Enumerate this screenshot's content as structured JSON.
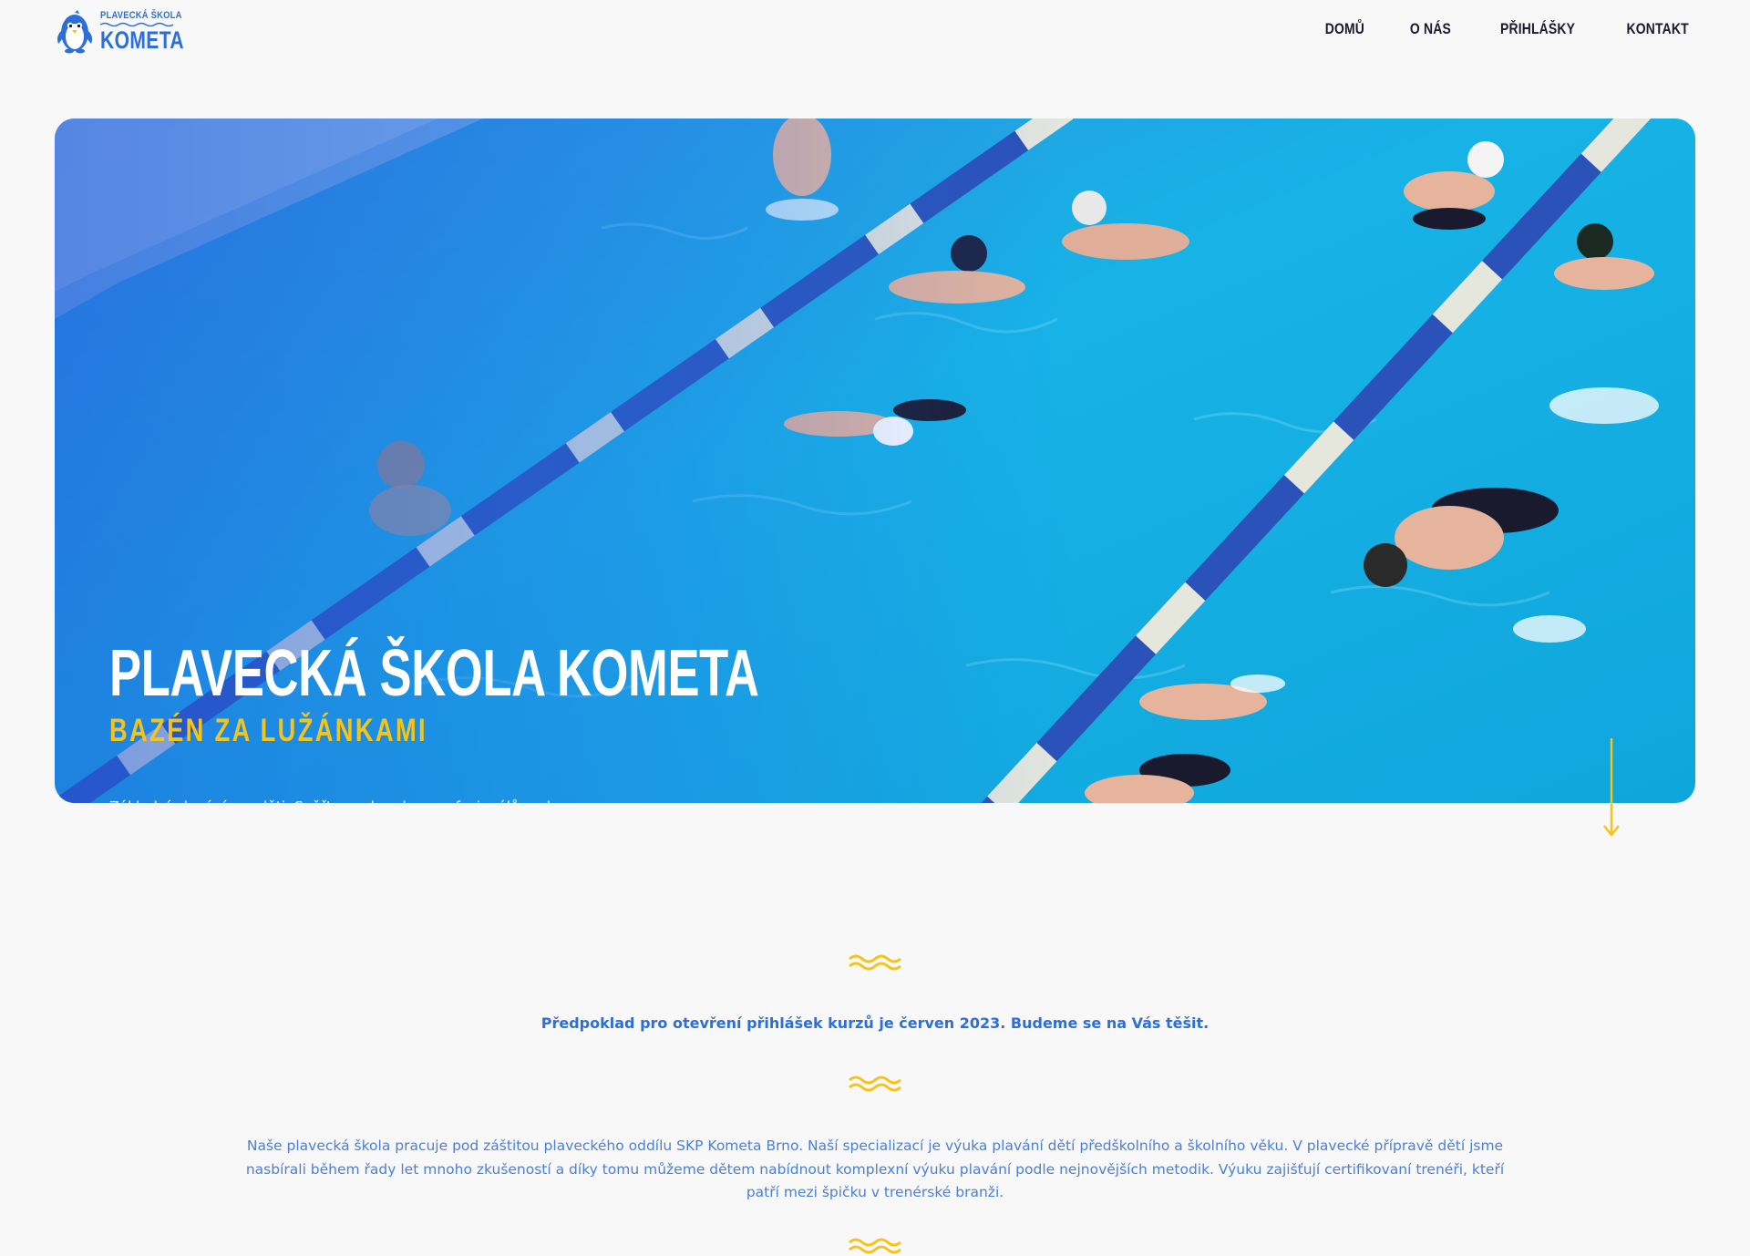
{
  "header": {
    "logo": {
      "top_text": "PLAVECKÁ ŠKOLA",
      "bottom_text": "KOMETA",
      "icon": "penguin-icon"
    },
    "nav": [
      {
        "label": "DOMŮ"
      },
      {
        "label": "O NÁS"
      },
      {
        "label": "PŘIHLÁŠKY"
      },
      {
        "label": "KONTAKT"
      }
    ]
  },
  "hero": {
    "title": "PLAVECKÁ ŠKOLA KOMETA",
    "subtitle": "BAZÉN ZA LUŽÁNKAMI",
    "description": "Základní plavání pro děti. Svěřte se do rukou profesionálů pod záštitou nejúspěšnějšího plaveckého klubu v České republice.",
    "scroll_icon": "arrow-down-icon"
  },
  "content": {
    "notice": "Předpoklad pro otevření přihlášek kurzů je červen 2023. Budeme se na Vás těšit.",
    "about": "Naše plavecká škola pracuje pod záštitou plaveckého oddílu SKP Kometa Brno. Naší specializací je výuka plavání dětí předškolního a školního věku. V plavecké přípravě dětí jsme nasbírali během řady let mnoho zkušeností a díky tomu můžeme dětem nabídnout komplexní výuku plavání podle nejnovějších metodik. Výuku zajišťují certifikovaní trenéři, kteří patří mezi špičku v trenérské branži.",
    "divider_icon": "wave-icon"
  },
  "colors": {
    "brand_blue": "#2d6fd6",
    "accent_yellow": "#f5c41a",
    "nav_text": "#1a1a2e",
    "background": "#f8f8f8"
  }
}
